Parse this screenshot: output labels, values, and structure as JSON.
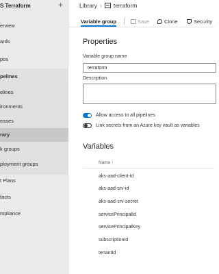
{
  "sidebar": {
    "title": "S Terraform",
    "items": [
      {
        "label": "erview",
        "kind": "item"
      },
      {
        "label": "ards",
        "kind": "item"
      },
      {
        "label": "pos",
        "kind": "item"
      },
      {
        "label": "pelines",
        "kind": "section"
      },
      {
        "label": "elines",
        "kind": "item"
      },
      {
        "label": "ironments",
        "kind": "item"
      },
      {
        "label": "eases",
        "kind": "item"
      },
      {
        "label": "rary",
        "kind": "selected"
      },
      {
        "label": "k groups",
        "kind": "item"
      },
      {
        "label": "ployment groups",
        "kind": "item"
      },
      {
        "label": "t Plans",
        "kind": "item"
      },
      {
        "label": "facts",
        "kind": "item"
      },
      {
        "label": "mpliance",
        "kind": "item"
      }
    ]
  },
  "breadcrumb": {
    "library": "Library",
    "current": "terraform"
  },
  "toolbar": {
    "tab": "Variable group",
    "save": "Save",
    "clone": "Clone",
    "security": "Security"
  },
  "properties": {
    "heading": "Properties",
    "name_label": "Variable group name",
    "name_value": "terraform",
    "description_label": "Description",
    "allow_access_label": "Allow access to all pipelines",
    "allow_access_on": true,
    "link_secrets_label": "Link secrets from an Azure key vault as variables",
    "link_secrets_on": false
  },
  "variables": {
    "heading": "Variables",
    "column_name": "Name",
    "rows": [
      "aks-aad-client-id",
      "aks-aad-srv-id",
      "aks-aad-srv-secret",
      "servicePrincipalId",
      "servicePrincipalKey",
      "subscriptionId",
      "tenantId"
    ]
  },
  "colors": {
    "accent": "#0078d4"
  }
}
